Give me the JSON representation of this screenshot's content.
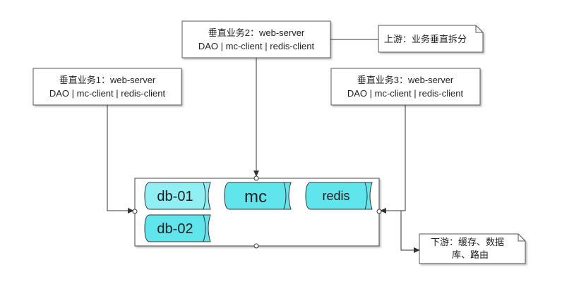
{
  "colors": {
    "storage_fill": "#5fe6ec",
    "storage_light": "#b8f6f8",
    "box_border": "#555555",
    "note_fill": "#ffffff",
    "line": "#333333"
  },
  "services": [
    {
      "title": "垂直业务1：web-server",
      "libs": "DAO | mc-client | redis-client"
    },
    {
      "title": "垂直业务2：web-server",
      "libs": "DAO | mc-client | redis-client"
    },
    {
      "title": "垂直业务3：web-server",
      "libs": "DAO | mc-client | redis-client"
    }
  ],
  "notes": {
    "upstream": "上游：业务垂直拆分",
    "downstream_line1": "下游：缓存、数据",
    "downstream_line2": "库、路由"
  },
  "storage": {
    "db01": "db-01",
    "mc": "mc",
    "redis": "redis",
    "db02": "db-02"
  }
}
